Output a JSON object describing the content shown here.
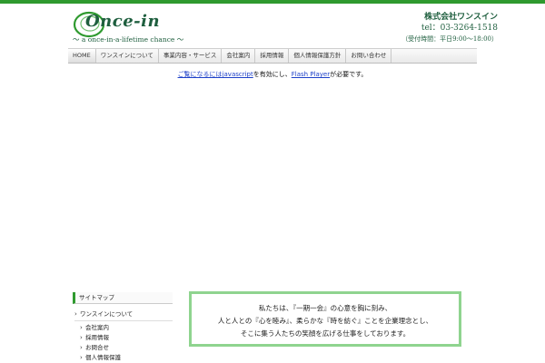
{
  "header": {
    "logo_text": "Once-in",
    "tagline": "～ a once-in-a-lifetime chance ～",
    "company_name": "株式会社ワンスイン",
    "tel": "tel：03-3264-1518",
    "hours": "（受付時間：平日9:00～18:00）"
  },
  "nav": {
    "items": [
      {
        "label": "HOME"
      },
      {
        "label": "ワンスインについて"
      },
      {
        "label": "事業内容・サービス"
      },
      {
        "label": "会社案内"
      },
      {
        "label": "採用情報"
      },
      {
        "label": "個人情報保護方針"
      },
      {
        "label": "お問い合わせ"
      }
    ]
  },
  "main": {
    "flash_notice": {
      "link1": "ご覧になるには",
      "link2": "javascript",
      "mid": "を有効にし、",
      "link3": "Flash Player",
      "end": "が必要です。"
    }
  },
  "sidebar": {
    "title": "サイトマップ",
    "items": [
      {
        "label": "ワンスインについて"
      },
      {
        "label": "会社案内"
      },
      {
        "label": "採用情報"
      },
      {
        "label": "お問合せ"
      },
      {
        "label": "個人情報保護"
      }
    ]
  },
  "philosophy": {
    "line1": "私たちは、『一期一会』の心意を胸に刻み、",
    "line2": "人と人との『心を睦み』、柔らかな『時を紡ぐ』ことを企業理念とし、",
    "line3": "そこに集う人たちの笑顔を広げる仕事をしております。"
  },
  "colors": {
    "accent_green": "#2f9a2f",
    "logo_green": "#1f5f3f",
    "frame_green": "#8fd48f",
    "link_blue": "#1d40c8"
  }
}
